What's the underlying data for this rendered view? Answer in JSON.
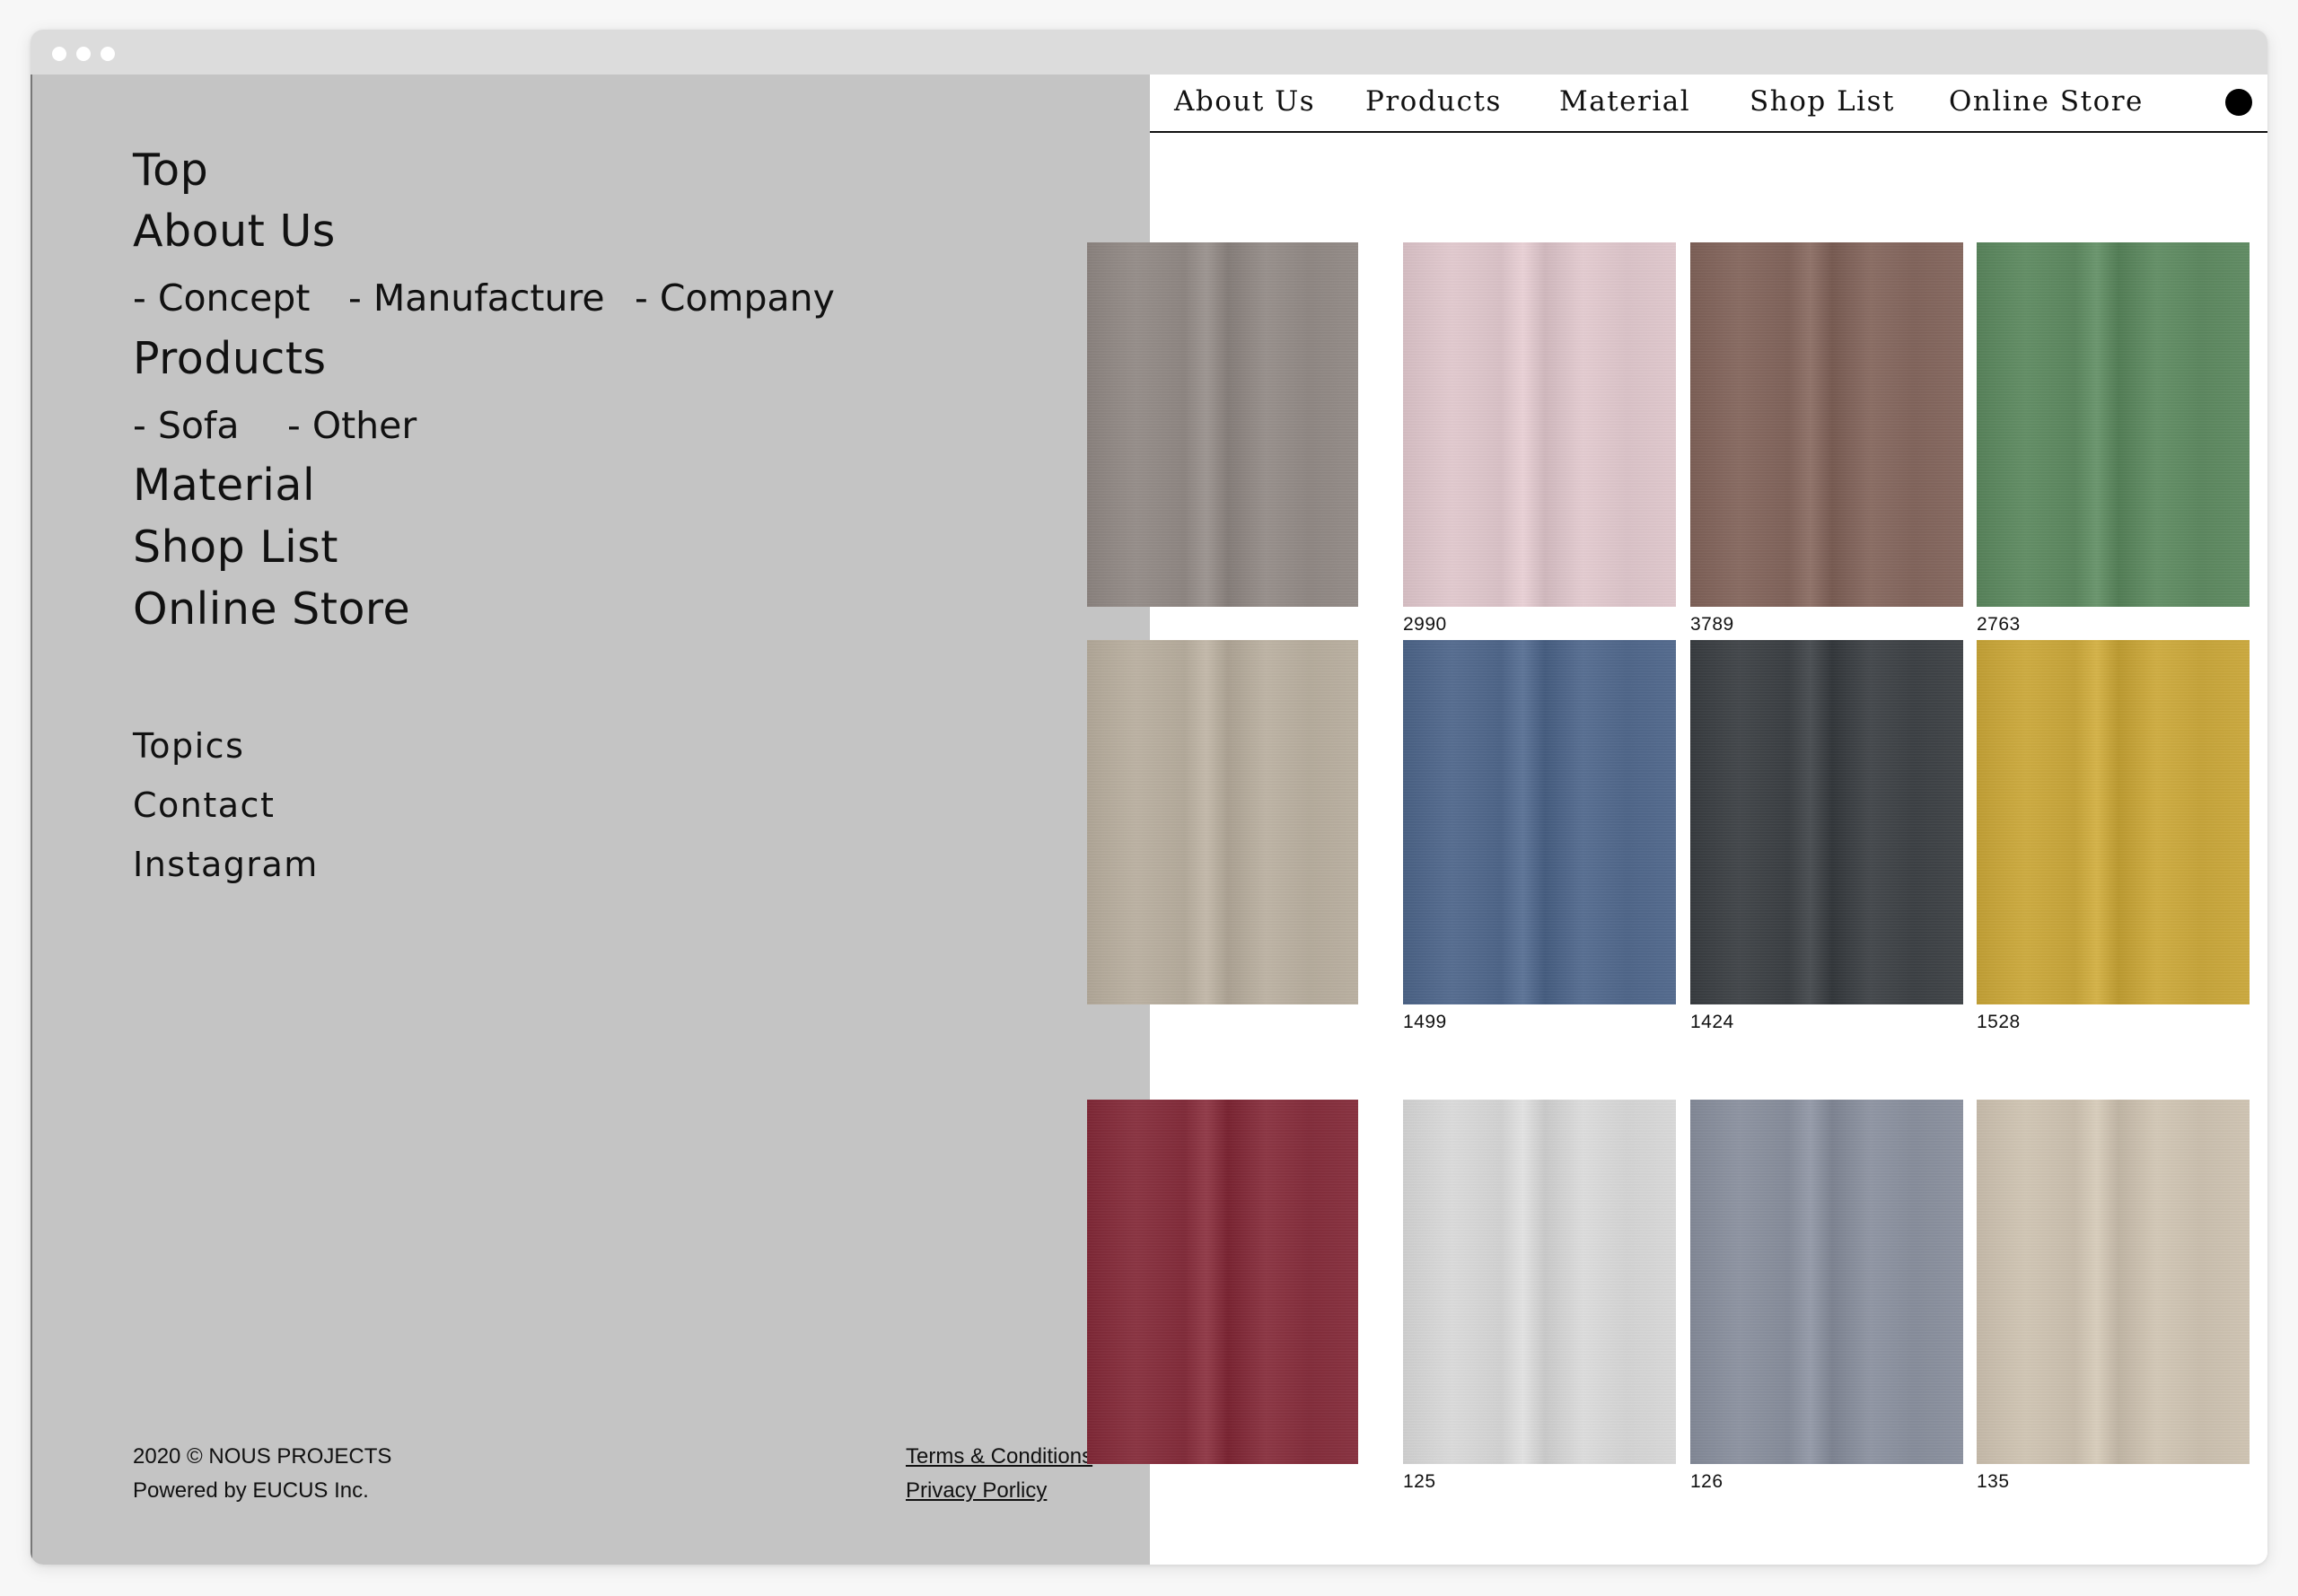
{
  "window": {
    "traffic_lights": [
      "window-close",
      "window-minimize",
      "window-maximize"
    ]
  },
  "menu": {
    "main": [
      {
        "label": "Top"
      },
      {
        "label": "About Us"
      },
      {
        "label": "Products"
      },
      {
        "label": "Material"
      },
      {
        "label": "Shop List"
      },
      {
        "label": "Online Store"
      }
    ],
    "about_sub": [
      "- Concept",
      "- Manufacture",
      "- Company"
    ],
    "products_sub": [
      "- Sofa",
      "- Other"
    ],
    "minor": [
      "Topics",
      "Contact",
      "Instagram"
    ],
    "copyright": "2020 © NOUS PROJECTS",
    "powered": "Powered by EUCUS Inc.",
    "terms": "Terms & Conditions",
    "privacy": "Privacy Porlicy",
    "panel_color": "#c4c4c4"
  },
  "nav": {
    "items": [
      "About Us",
      "Products",
      "Material",
      "Shop List",
      "Online Store"
    ],
    "dot_icon": "circle-icon"
  },
  "swatches": [
    {
      "code": "",
      "color": "#928a86"
    },
    {
      "code": "2990",
      "color": "#dec6cb"
    },
    {
      "code": "3789",
      "color": "#84675e"
    },
    {
      "code": "2763",
      "color": "#5f8a62"
    },
    {
      "code": "",
      "color": "#b8ae9f"
    },
    {
      "code": "1499",
      "color": "#52698c"
    },
    {
      "code": "1424",
      "color": "#3f4347"
    },
    {
      "code": "1528",
      "color": "#c9a73d"
    },
    {
      "code": "",
      "color": "#86303e"
    },
    {
      "code": "125",
      "color": "#d7d7d7"
    },
    {
      "code": "126",
      "color": "#8a909e"
    },
    {
      "code": "135",
      "color": "#cdc2b1"
    }
  ]
}
